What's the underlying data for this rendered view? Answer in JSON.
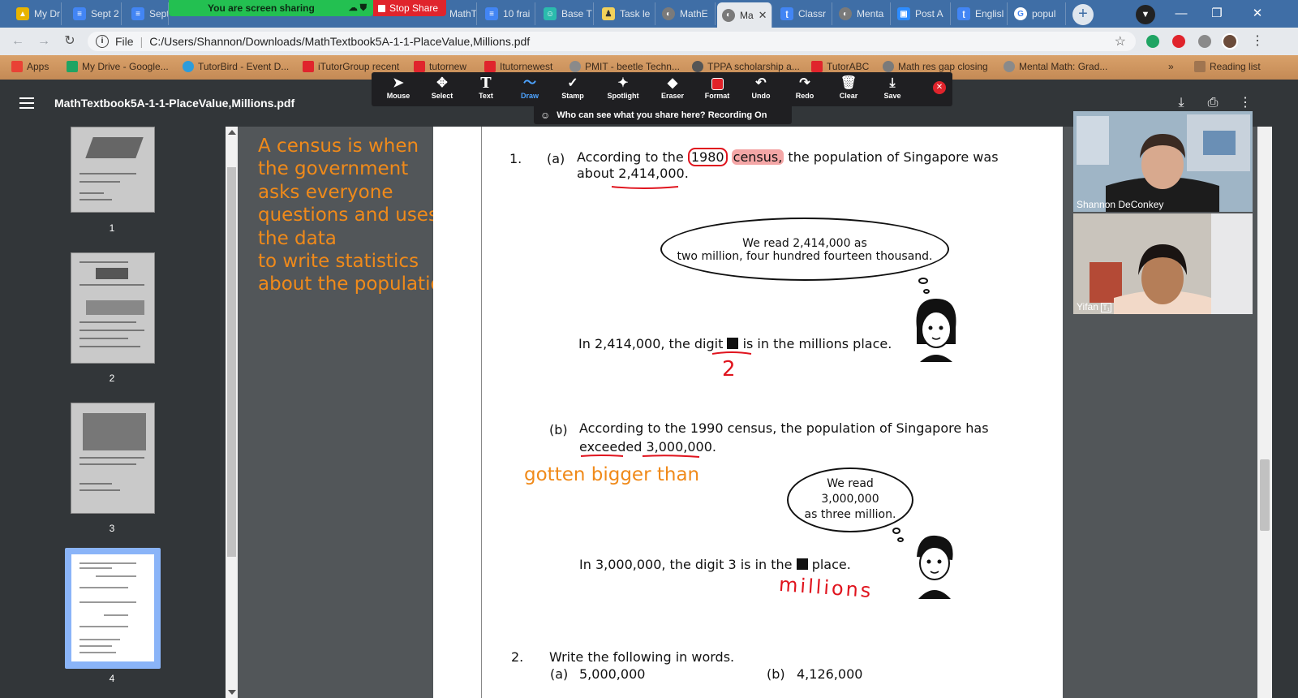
{
  "browser": {
    "tabs": [
      {
        "label": "My Dr",
        "color": "#e8b400"
      },
      {
        "label": "Sept 2",
        "color": "#4285f4"
      },
      {
        "label": "Sept",
        "color": "#4285f4"
      },
      {
        "label": "MathT",
        "color": "#4285f4"
      },
      {
        "label": "10 frai",
        "color": "#4285f4"
      },
      {
        "label": "Base T",
        "color": "#2bbbad"
      },
      {
        "label": "Task le",
        "color": "#f2d15a"
      },
      {
        "label": "MathE",
        "color": "#7a7a7a"
      },
      {
        "label": "Ma",
        "color": "#7a7a7a"
      },
      {
        "label": "Classr",
        "color": "#4285f4"
      },
      {
        "label": "Menta",
        "color": "#7a7a7a"
      },
      {
        "label": "Post A",
        "color": "#2d8cff"
      },
      {
        "label": "Englisl",
        "color": "#4285f4"
      },
      {
        "label": "popul",
        "color": "#ffffff"
      }
    ],
    "new_tab": "+",
    "url_scheme": "File",
    "url": "C:/Users/Shannon/Downloads/MathTextbook5A-1-1-PlaceValue,Millions.pdf",
    "bookmarks": [
      {
        "label": "Apps",
        "color": "#e94235"
      },
      {
        "label": "My Drive - Google...",
        "color": "#1fa463"
      },
      {
        "label": "TutorBird - Event D...",
        "color": "#2d9cdb"
      },
      {
        "label": "iTutorGroup recent",
        "color": "#e0242c"
      },
      {
        "label": "tutornew",
        "color": "#e0242c"
      },
      {
        "label": "Itutornewest",
        "color": "#e0242c"
      },
      {
        "label": "PMIT - beetle Techn...",
        "color": "#8a8a8a"
      },
      {
        "label": "TPPA scholarship a...",
        "color": "#555555"
      },
      {
        "label": "TutorABC",
        "color": "#e0242c"
      },
      {
        "label": "Math res gap closing",
        "color": "#7a7a7a"
      },
      {
        "label": "Mental Math: Grad...",
        "color": "#8a8a8a"
      }
    ],
    "reading_list": "Reading list"
  },
  "zoom": {
    "sharing_text": "You are screen sharing",
    "stop_share": "Stop Share",
    "recording_text": "Who can see what you share here? Recording On",
    "tools": [
      {
        "label": "Mouse",
        "glyph": "➤"
      },
      {
        "label": "Select",
        "glyph": "✥"
      },
      {
        "label": "Text",
        "glyph": "T"
      },
      {
        "label": "Draw",
        "glyph": "〜"
      },
      {
        "label": "Stamp",
        "glyph": "✓"
      },
      {
        "label": "Spotlight",
        "glyph": "✦"
      },
      {
        "label": "Eraser",
        "glyph": "◆"
      },
      {
        "label": "Format",
        "glyph": ""
      },
      {
        "label": "Undo",
        "glyph": "↶"
      },
      {
        "label": "Redo",
        "glyph": "↷"
      },
      {
        "label": "Clear",
        "glyph": "🗑"
      },
      {
        "label": "Save",
        "glyph": "⤓"
      }
    ],
    "selected_tool": "Draw",
    "participants": [
      {
        "name": "Shannon DeConkey"
      },
      {
        "name": "Yifan"
      }
    ]
  },
  "pdf": {
    "title": "MathTextbook5A-1-1-PlaceValue,Millions.pdf",
    "thumbnail_pages": [
      "1",
      "2",
      "3",
      "4"
    ],
    "current_page": "4"
  },
  "page": {
    "note_orange": [
      "A census is when",
      "the government",
      "asks everyone",
      "questions and uses",
      "the data",
      "to write statistics",
      "about the population."
    ],
    "q1_num": "1.",
    "q1a_label": "(a)",
    "q1a_line1_pre": "According to the",
    "q1a_year": "1980",
    "q1a_census": "census,",
    "q1a_line1_post": "the population of Singapore was",
    "q1a_line2_pre": "about",
    "q1a_number": "2,414,000",
    "q1a_line2_post": ".",
    "cloud1_line1": "We read 2,414,000 as",
    "cloud1_line2": "two million, four hundred fourteen thousand.",
    "q1a_stmt_pre": "In 2,414,000, the digit",
    "q1a_stmt_post": "is in the millions place.",
    "ink_answer_a": "2",
    "q1b_label": "(b)",
    "q1b_line1": "According to the 1990 census, the population of Singapore has",
    "q1b_word": "exceeded",
    "q1b_number": "3,000,000",
    "q1b_line2_post": ".",
    "note_exceeded": "gotten bigger than",
    "cloud2_line1": "We read",
    "cloud2_line2": "3,000,000",
    "cloud2_line3": "as three million.",
    "q1b_stmt_pre": "In 3,000,000, the digit 3 is in the",
    "q1b_stmt_post": "place.",
    "ink_answer_b": "millions",
    "q2_num": "2.",
    "q2_text": "Write the following in words.",
    "q2a_label": "(a)",
    "q2a_value": "5,000,000",
    "q2b_label": "(b)",
    "q2b_value": "4,126,000"
  }
}
